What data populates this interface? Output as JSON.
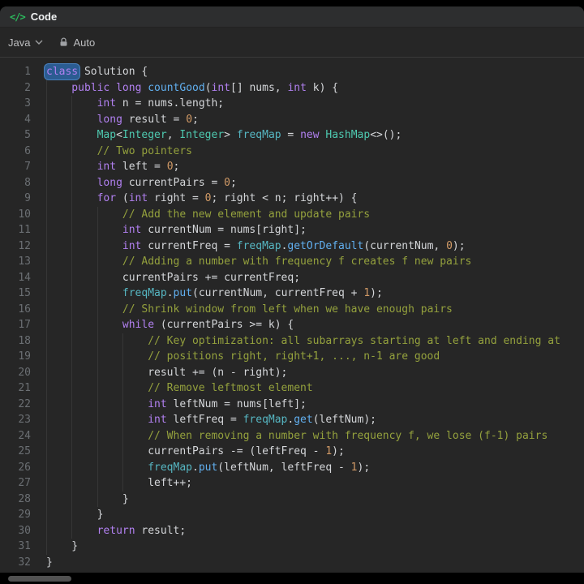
{
  "app": {
    "header": {
      "icon_glyph": "</>",
      "title": "Code"
    },
    "toolbar": {
      "language": "Java",
      "autosave_label": "Auto"
    }
  },
  "colors": {
    "accent_green": "#2cbb5d",
    "editor_background": "#262626",
    "keyword": "#b180f0",
    "type": "#4ec9b0",
    "function": "#61afef",
    "comment": "#94a13d",
    "number": "#d19a66",
    "variable_teal": "#56b6c2",
    "default_text": "#d4d6d9",
    "selection_highlight": "#2b5c92"
  },
  "code": {
    "line_count": 32,
    "lines": [
      {
        "indent": 0,
        "tokens": [
          [
            "class",
            "kw sel"
          ],
          [
            " ",
            ""
          ],
          [
            "Solution",
            ""
          ],
          [
            " {",
            ""
          ]
        ]
      },
      {
        "indent": 4,
        "tokens": [
          [
            "public",
            "kw"
          ],
          [
            " ",
            ""
          ],
          [
            "long",
            "kw"
          ],
          [
            " ",
            ""
          ],
          [
            "countGood",
            "fn"
          ],
          [
            "(",
            ""
          ],
          [
            "int",
            "kw"
          ],
          [
            "[] nums, ",
            ""
          ],
          [
            "int",
            "kw"
          ],
          [
            " k) {",
            ""
          ]
        ]
      },
      {
        "indent": 8,
        "tokens": [
          [
            "int",
            "kw"
          ],
          [
            " n = nums.length;",
            ""
          ]
        ]
      },
      {
        "indent": 8,
        "tokens": [
          [
            "long",
            "kw"
          ],
          [
            " result = ",
            ""
          ],
          [
            "0",
            "num"
          ],
          [
            ";",
            ""
          ]
        ]
      },
      {
        "indent": 8,
        "tokens": [
          [
            "Map",
            "type"
          ],
          [
            "<",
            ""
          ],
          [
            "Integer",
            "type"
          ],
          [
            ", ",
            ""
          ],
          [
            "Integer",
            "type"
          ],
          [
            "> ",
            ""
          ],
          [
            "freqMap",
            "var2"
          ],
          [
            " = ",
            ""
          ],
          [
            "new",
            "kw"
          ],
          [
            " ",
            ""
          ],
          [
            "HashMap",
            "type"
          ],
          [
            "<>();",
            ""
          ]
        ]
      },
      {
        "indent": 8,
        "tokens": [
          [
            "// Two pointers",
            "cmt"
          ]
        ]
      },
      {
        "indent": 8,
        "tokens": [
          [
            "int",
            "kw"
          ],
          [
            " left = ",
            ""
          ],
          [
            "0",
            "num"
          ],
          [
            ";",
            ""
          ]
        ]
      },
      {
        "indent": 8,
        "tokens": [
          [
            "long",
            "kw"
          ],
          [
            " currentPairs = ",
            ""
          ],
          [
            "0",
            "num"
          ],
          [
            ";",
            ""
          ]
        ]
      },
      {
        "indent": 8,
        "tokens": [
          [
            "for",
            "kw"
          ],
          [
            " (",
            ""
          ],
          [
            "int",
            "kw"
          ],
          [
            " right = ",
            ""
          ],
          [
            "0",
            "num"
          ],
          [
            "; right < n; right++) {",
            ""
          ]
        ]
      },
      {
        "indent": 12,
        "tokens": [
          [
            "// Add the new element and update pairs",
            "cmt"
          ]
        ]
      },
      {
        "indent": 12,
        "tokens": [
          [
            "int",
            "kw"
          ],
          [
            " currentNum = nums[right];",
            ""
          ]
        ]
      },
      {
        "indent": 12,
        "tokens": [
          [
            "int",
            "kw"
          ],
          [
            " currentFreq = ",
            ""
          ],
          [
            "freqMap",
            "var2"
          ],
          [
            ".",
            ""
          ],
          [
            "getOrDefault",
            "fn"
          ],
          [
            "(currentNum, ",
            ""
          ],
          [
            "0",
            "num"
          ],
          [
            ");",
            ""
          ]
        ]
      },
      {
        "indent": 12,
        "tokens": [
          [
            "// Adding a number with frequency f creates f new pairs",
            "cmt"
          ]
        ]
      },
      {
        "indent": 12,
        "tokens": [
          [
            "currentPairs += currentFreq;",
            ""
          ]
        ]
      },
      {
        "indent": 12,
        "tokens": [
          [
            "freqMap",
            "var2"
          ],
          [
            ".",
            ""
          ],
          [
            "put",
            "fn"
          ],
          [
            "(currentNum, currentFreq + ",
            ""
          ],
          [
            "1",
            "num"
          ],
          [
            ");",
            ""
          ]
        ]
      },
      {
        "indent": 12,
        "tokens": [
          [
            "// Shrink window from left when we have enough pairs",
            "cmt"
          ]
        ]
      },
      {
        "indent": 12,
        "tokens": [
          [
            "while",
            "kw"
          ],
          [
            " (currentPairs >= k) {",
            ""
          ]
        ]
      },
      {
        "indent": 16,
        "tokens": [
          [
            "// Key optimization: all subarrays starting at left and ending at",
            "cmt"
          ]
        ]
      },
      {
        "indent": 16,
        "tokens": [
          [
            "// positions right, right+1, ..., n-1 are good",
            "cmt"
          ]
        ]
      },
      {
        "indent": 16,
        "tokens": [
          [
            "result += (n - right);",
            ""
          ]
        ]
      },
      {
        "indent": 16,
        "tokens": [
          [
            "// Remove leftmost element",
            "cmt"
          ]
        ]
      },
      {
        "indent": 16,
        "tokens": [
          [
            "int",
            "kw"
          ],
          [
            " leftNum = nums[left];",
            ""
          ]
        ]
      },
      {
        "indent": 16,
        "tokens": [
          [
            "int",
            "kw"
          ],
          [
            " leftFreq = ",
            ""
          ],
          [
            "freqMap",
            "var2"
          ],
          [
            ".",
            ""
          ],
          [
            "get",
            "fn"
          ],
          [
            "(leftNum);",
            ""
          ]
        ]
      },
      {
        "indent": 16,
        "tokens": [
          [
            "// When removing a number with frequency f, we lose (f-1) pairs",
            "cmt"
          ]
        ]
      },
      {
        "indent": 16,
        "tokens": [
          [
            "currentPairs -= (leftFreq - ",
            ""
          ],
          [
            "1",
            "num"
          ],
          [
            ");",
            ""
          ]
        ]
      },
      {
        "indent": 16,
        "tokens": [
          [
            "freqMap",
            "var2"
          ],
          [
            ".",
            ""
          ],
          [
            "put",
            "fn"
          ],
          [
            "(leftNum, leftFreq - ",
            ""
          ],
          [
            "1",
            "num"
          ],
          [
            ");",
            ""
          ]
        ]
      },
      {
        "indent": 16,
        "tokens": [
          [
            "left++;",
            ""
          ]
        ]
      },
      {
        "indent": 12,
        "tokens": [
          [
            "}",
            ""
          ]
        ]
      },
      {
        "indent": 8,
        "tokens": [
          [
            "}",
            ""
          ]
        ]
      },
      {
        "indent": 8,
        "tokens": [
          [
            "return",
            "kw"
          ],
          [
            " result;",
            ""
          ]
        ]
      },
      {
        "indent": 4,
        "tokens": [
          [
            "}",
            ""
          ]
        ]
      },
      {
        "indent": 0,
        "tokens": [
          [
            "}",
            ""
          ]
        ]
      }
    ]
  }
}
